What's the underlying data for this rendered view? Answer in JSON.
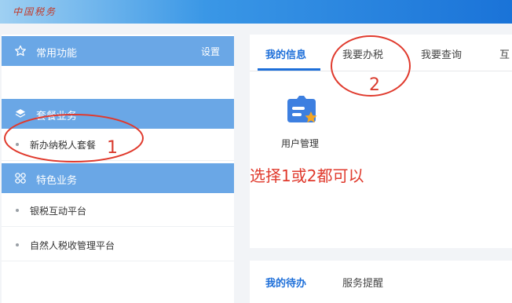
{
  "header": {
    "logo_text": "中国税务"
  },
  "sidebar": {
    "common": {
      "title": "常用功能",
      "action": "设置",
      "icon": "star-icon"
    },
    "package": {
      "title": "套餐业务",
      "icon": "layers-icon",
      "items": [
        {
          "label": "新办纳税人套餐"
        }
      ]
    },
    "special": {
      "title": "特色业务",
      "icon": "grid-icon",
      "items": [
        {
          "label": "银税互动平台"
        },
        {
          "label": "自然人税收管理平台"
        }
      ]
    }
  },
  "main": {
    "tabs": [
      {
        "label": "我的信息",
        "active": true
      },
      {
        "label": "我要办税",
        "active": false
      },
      {
        "label": "我要查询",
        "active": false
      },
      {
        "label": "互",
        "active": false
      }
    ],
    "apps": [
      {
        "label": "用户管理",
        "icon": "user-manage-icon"
      }
    ],
    "bottom_tabs": [
      {
        "label": "我的待办",
        "active": true
      },
      {
        "label": "服务提醒",
        "active": false
      }
    ]
  },
  "annotations": {
    "mark_1": "1",
    "mark_2": "2",
    "note": "选择1或2都可以",
    "color": "#e03a2d"
  },
  "colors": {
    "accent": "#1e6fd9",
    "sidebar_header": "#6aa7e6",
    "page_bg": "#f2f4f7"
  }
}
